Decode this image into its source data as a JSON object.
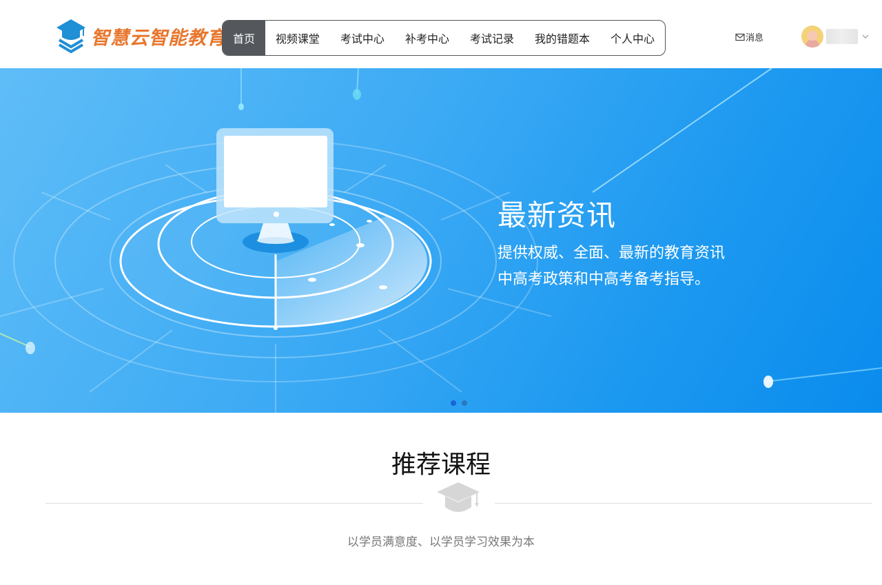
{
  "brand": {
    "name": "智慧云智能教育平台",
    "logo_color": "#e8762c",
    "icon_color": "#1f8fd6"
  },
  "nav": {
    "items": [
      {
        "label": "首页",
        "active": true
      },
      {
        "label": "视频课堂",
        "active": false
      },
      {
        "label": "考试中心",
        "active": false
      },
      {
        "label": "补考中心",
        "active": false
      },
      {
        "label": "考试记录",
        "active": false
      },
      {
        "label": "我的错题本",
        "active": false
      },
      {
        "label": "个人中心",
        "active": false
      }
    ]
  },
  "header": {
    "messages_label": "消息"
  },
  "banner": {
    "title": "最新资讯",
    "subtitle_line1": "提供权威、全面、最新的教育资讯",
    "subtitle_line2": "中高考政策和中高考备考指导。",
    "slide_count": 2,
    "active_slide": 1
  },
  "recommended": {
    "title": "推荐课程",
    "subtitle": "以学员满意度、以学员学习效果为本"
  },
  "colors": {
    "nav_active_bg": "#54585c",
    "banner_start": "#5fbdf7",
    "banner_end": "#0a8ced"
  }
}
